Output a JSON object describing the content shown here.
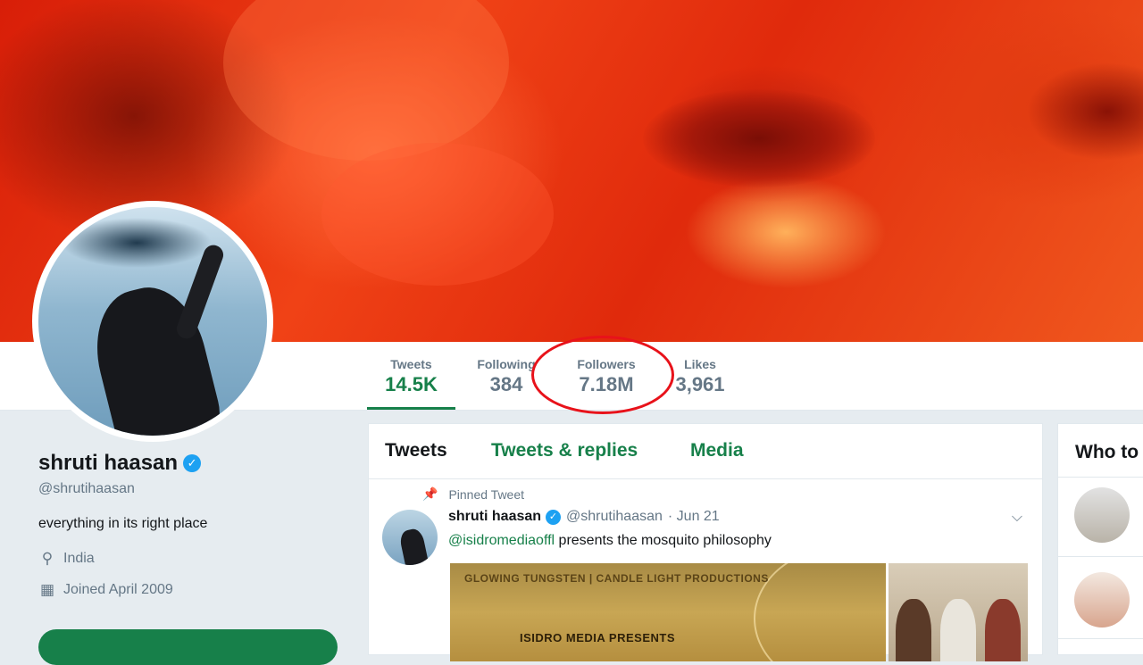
{
  "banner": {
    "alt": ""
  },
  "stats": [
    {
      "label": "Tweets",
      "value": "14.5K"
    },
    {
      "label": "Following",
      "value": "384"
    },
    {
      "label": "Followers",
      "value": "7.18M"
    },
    {
      "label": "Likes",
      "value": "3,961"
    }
  ],
  "profile": {
    "name": "shruti haasan",
    "handle": "@shrutihaasan",
    "bio": "everything in its right place",
    "location": "India",
    "joined": "Joined April 2009"
  },
  "timeline": {
    "tabs": [
      "Tweets",
      "Tweets & replies",
      "Media"
    ],
    "pinned_label": "Pinned Tweet",
    "tweet": {
      "name": "shruti haasan",
      "handle": "@shrutihaasan",
      "date": "· Jun 21",
      "mention": "@isidromediaoffl",
      "text": " presents the mosquito philosophy",
      "media_text_1": "GLOWING TUNGSTEN  |  CANDLE LIGHT PRODUCTIONS",
      "media_text_2": "ISIDRO MEDIA PRESENTS"
    }
  },
  "sidebar": {
    "who_to_follow_title": "Who to"
  },
  "icons": {
    "verified": "verified-check-icon",
    "location": "map-pin-icon",
    "calendar": "calendar-icon",
    "pin": "pin-icon",
    "caret": "chevron-down-icon"
  },
  "colors": {
    "accent": "#17804a",
    "verified": "#1da1f2",
    "annotation": "#e8121a"
  }
}
